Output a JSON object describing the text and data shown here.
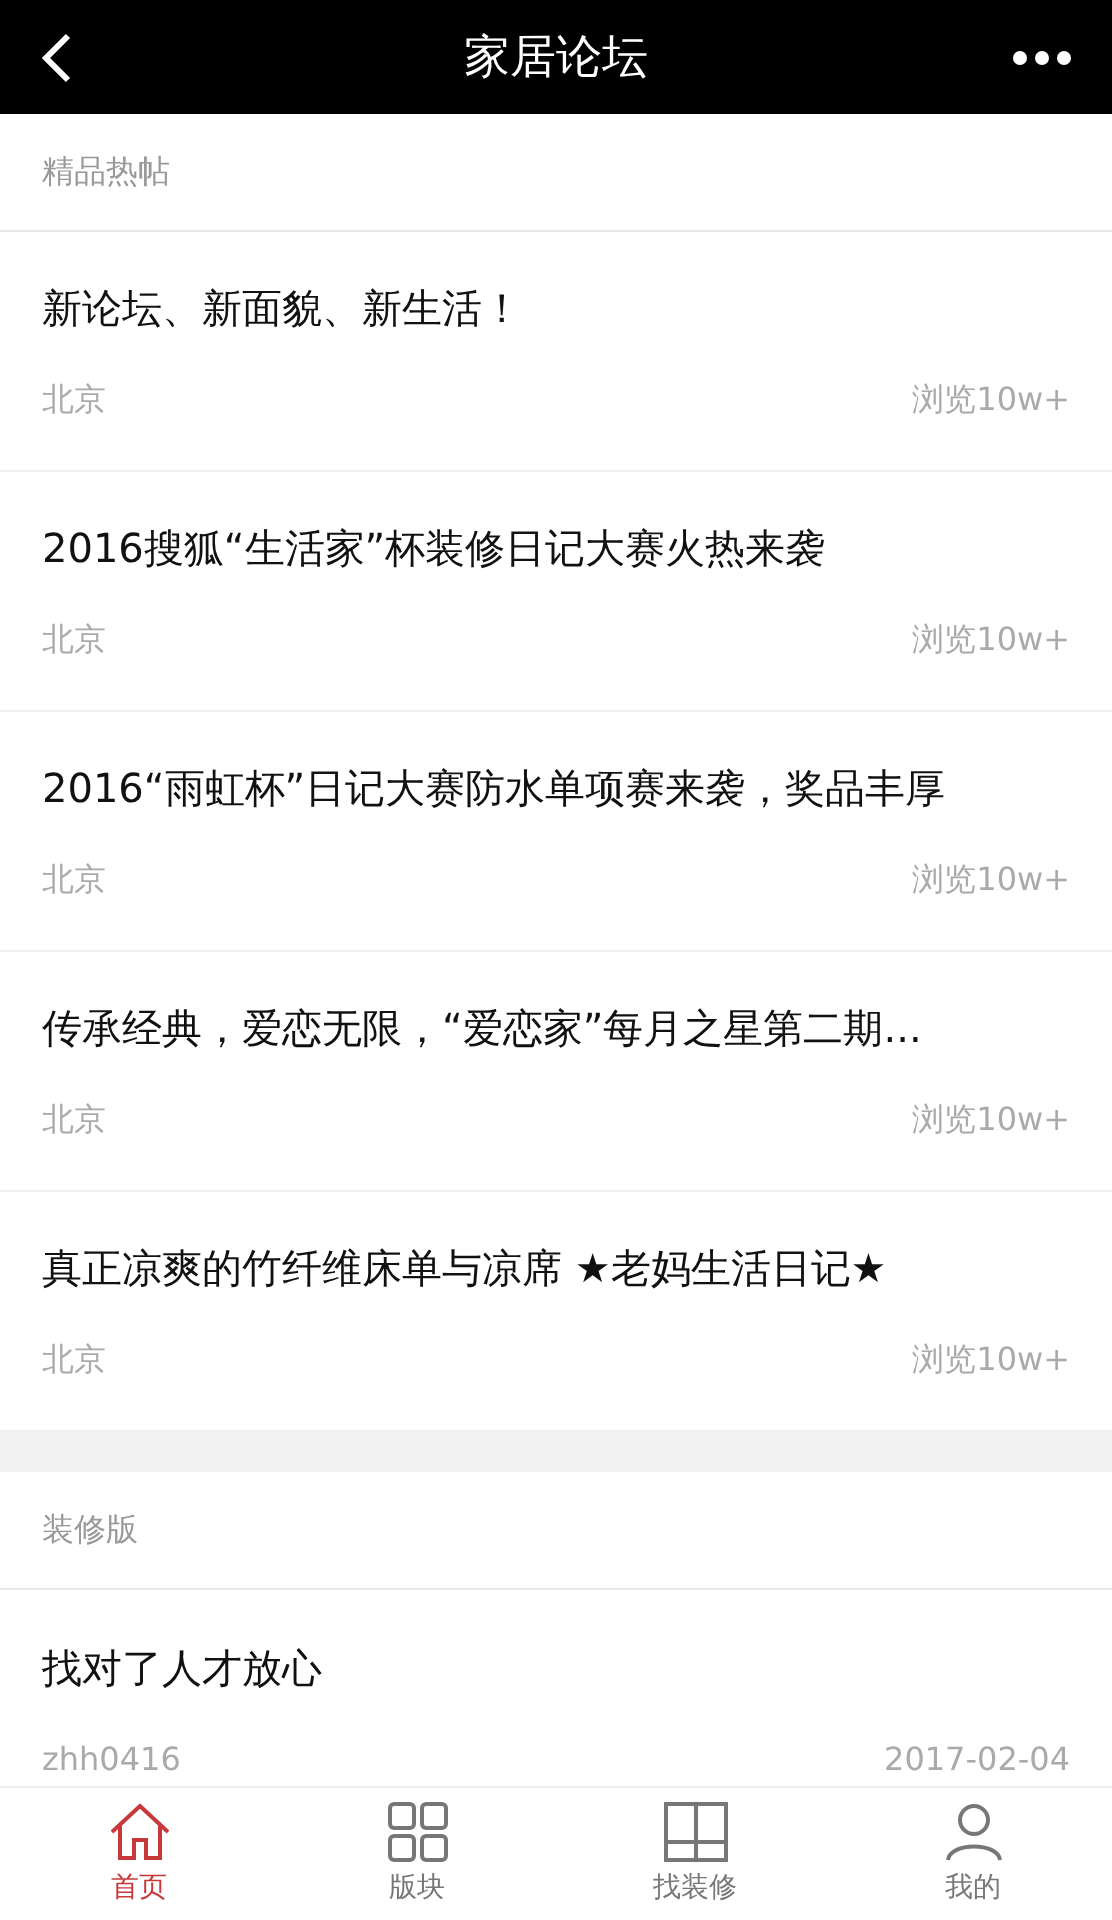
{
  "header": {
    "title": "家居论坛"
  },
  "sections": [
    {
      "title": "精品热帖",
      "posts": [
        {
          "title": "新论坛、新面貌、新生活！",
          "author": "北京",
          "meta": "浏览10w+"
        },
        {
          "title": "2016搜狐“生活家”杯装修日记大赛火热来袭",
          "author": "北京",
          "meta": "浏览10w+"
        },
        {
          "title": "2016“雨虹杯”日记大赛防水单项赛来袭，奖品丰厚",
          "author": "北京",
          "meta": "浏览10w+"
        },
        {
          "title": "传承经典，爱恋无限，“爱恋家”每月之星第二期...",
          "author": "北京",
          "meta": "浏览10w+"
        },
        {
          "title": "真正凉爽的竹纤维床单与凉席 ★老妈生活日记★",
          "author": "北京",
          "meta": "浏览10w+"
        }
      ]
    },
    {
      "title": "装修版",
      "posts": [
        {
          "title": "找对了人才放心",
          "author": "zhh0416",
          "meta": "2017-02-04"
        }
      ]
    }
  ],
  "tabs": [
    {
      "label": "首页",
      "kind": "home",
      "selected": true
    },
    {
      "label": "版块",
      "kind": "grid",
      "selected": false
    },
    {
      "label": "找装修",
      "kind": "panel",
      "selected": false
    },
    {
      "label": "我的",
      "kind": "person",
      "selected": false
    }
  ]
}
